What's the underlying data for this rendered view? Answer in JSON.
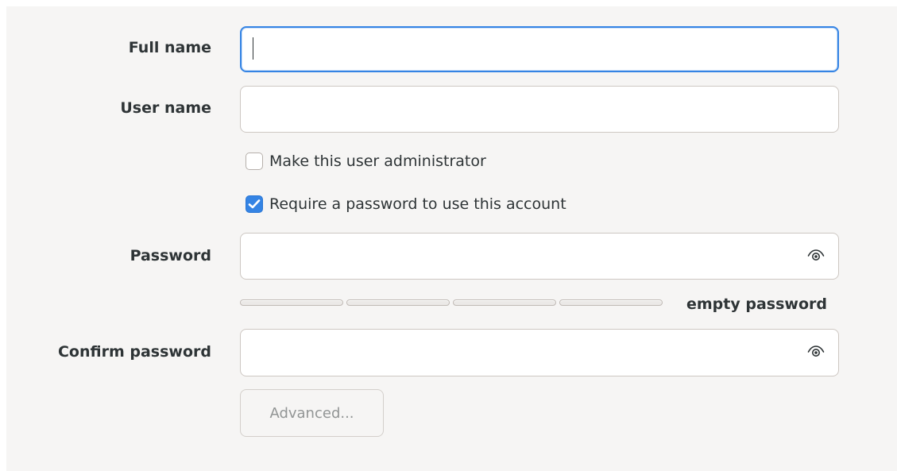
{
  "form": {
    "full_name": {
      "label": "Full name",
      "value": ""
    },
    "user_name": {
      "label": "User name",
      "value": ""
    },
    "admin_checkbox": {
      "label": "Make this user administrator",
      "checked": false
    },
    "require_password_checkbox": {
      "label": "Require a password to use this account",
      "checked": true
    },
    "password": {
      "label": "Password",
      "value": "",
      "toggle_icon": "eye-icon"
    },
    "strength": {
      "text": "empty password",
      "level": 0,
      "segments": 4
    },
    "confirm_password": {
      "label": "Confirm password",
      "value": "",
      "toggle_icon": "eye-icon"
    },
    "advanced_button": {
      "label": "Advanced...",
      "enabled": false
    }
  },
  "colors": {
    "background": "#f6f5f4",
    "accent": "#3584e4",
    "text": "#2e3436",
    "disabled_text": "#929595"
  }
}
